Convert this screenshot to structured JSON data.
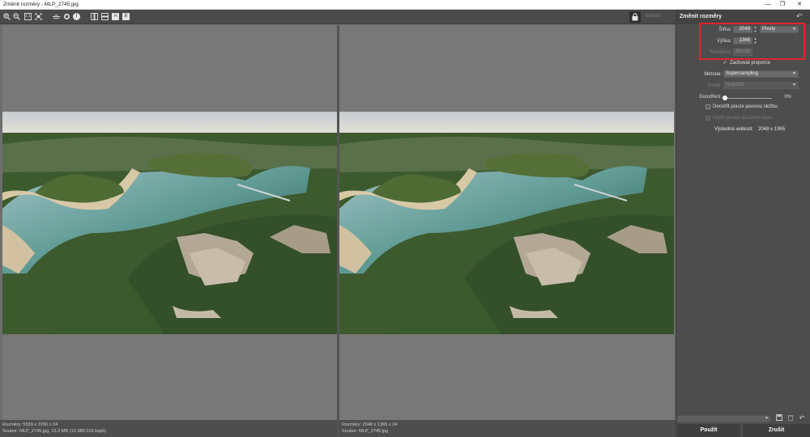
{
  "window": {
    "title": "Změnit rozměry - MLP_2745.jpg",
    "minimize_glyph": "—",
    "restore_glyph": "❐",
    "close_glyph": "✕"
  },
  "toolbar": {
    "icons": [
      "zoom-in-icon",
      "zoom-out-icon",
      "zoom-100-icon",
      "fit-to-window-icon",
      "horizon-icon",
      "circle-icon",
      "info-icon",
      "split-vertical-icon",
      "split-horizontal-icon",
      "view-a-icon",
      "view-b-icon"
    ],
    "zoom_100": "1:1",
    "info": "i",
    "view_a": "A",
    "view_b": "B",
    "compare_label": "Náhled"
  },
  "status": {
    "left_line1": "Rozměry: 5559 x 3706 x 24",
    "left_line2": "Soubor: MLP_2745.jpg, 13.3 MB (13 985 016 bajtů)",
    "right_line1": "Rozměry: 2048 x 1365 x 24",
    "right_line2": "Soubor: MLP_2745.jpg"
  },
  "panel": {
    "title": "Změnit rozměry",
    "undo_icon": "↶",
    "width_label": "Šířka:",
    "width_value": "2048",
    "unit_value": "Pixely",
    "height_label": "Výška:",
    "height_value": "1365",
    "resolution_label": "Rozlišení:",
    "resolution_value": "300.00",
    "keep_ratio_label": "Zachovat proporce",
    "method_label": "Metoda:",
    "method_value": "Supersampling",
    "filter_label": "Podle:",
    "filter_value": "Nejbližší",
    "sharpen_label": "Doostření:",
    "sharpen_value": "0%",
    "sharpen_level": 0,
    "sharpen_luma_label": "Doostřit pouze jasovou složku",
    "keep_metadata_label": "Uložit pouze obrazová data",
    "result_label": "Výsledná velikost:",
    "result_value": "2048 x 1365"
  },
  "footer": {
    "save_icon": "save-icon",
    "delete_icon": "trash-icon",
    "reset_icon": "undo-icon",
    "apply_label": "Použít",
    "cancel_label": "Zrušit"
  }
}
